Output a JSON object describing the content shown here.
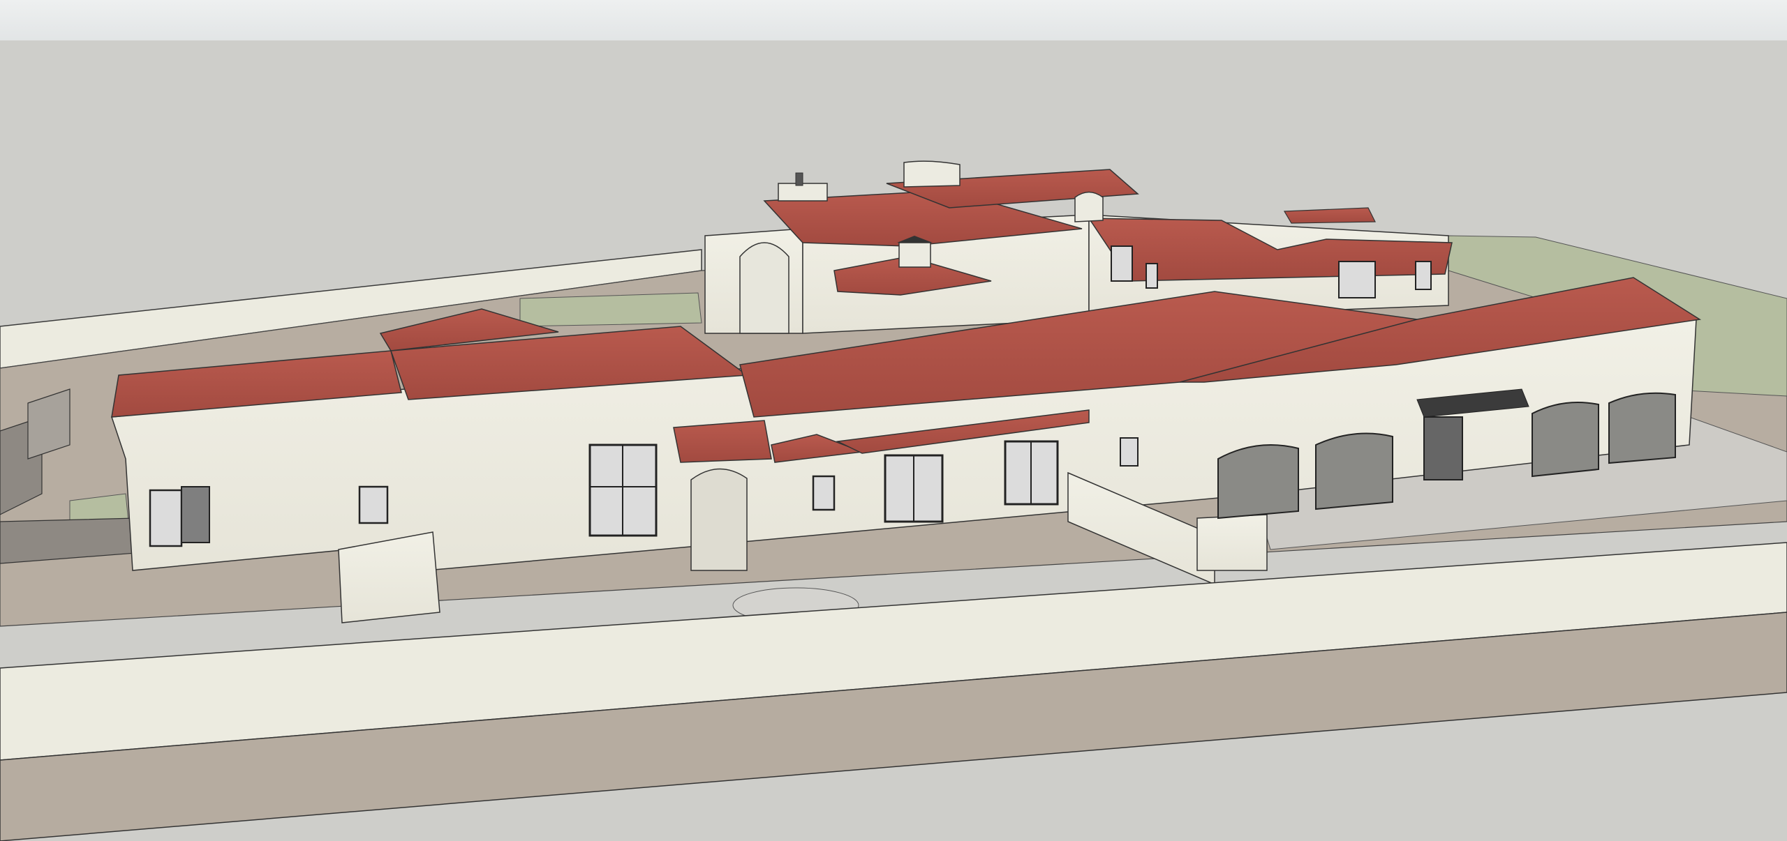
{
  "app": {
    "title": ""
  },
  "viewport": {
    "background_color": "#cececa",
    "model": {
      "name": "",
      "roof_color": "#b2554a",
      "wall_color": "#ecebe1",
      "ground_color": "#b6aca0",
      "lawn_color": "#b5bea0",
      "paving_color": "#cdcbc6"
    }
  }
}
